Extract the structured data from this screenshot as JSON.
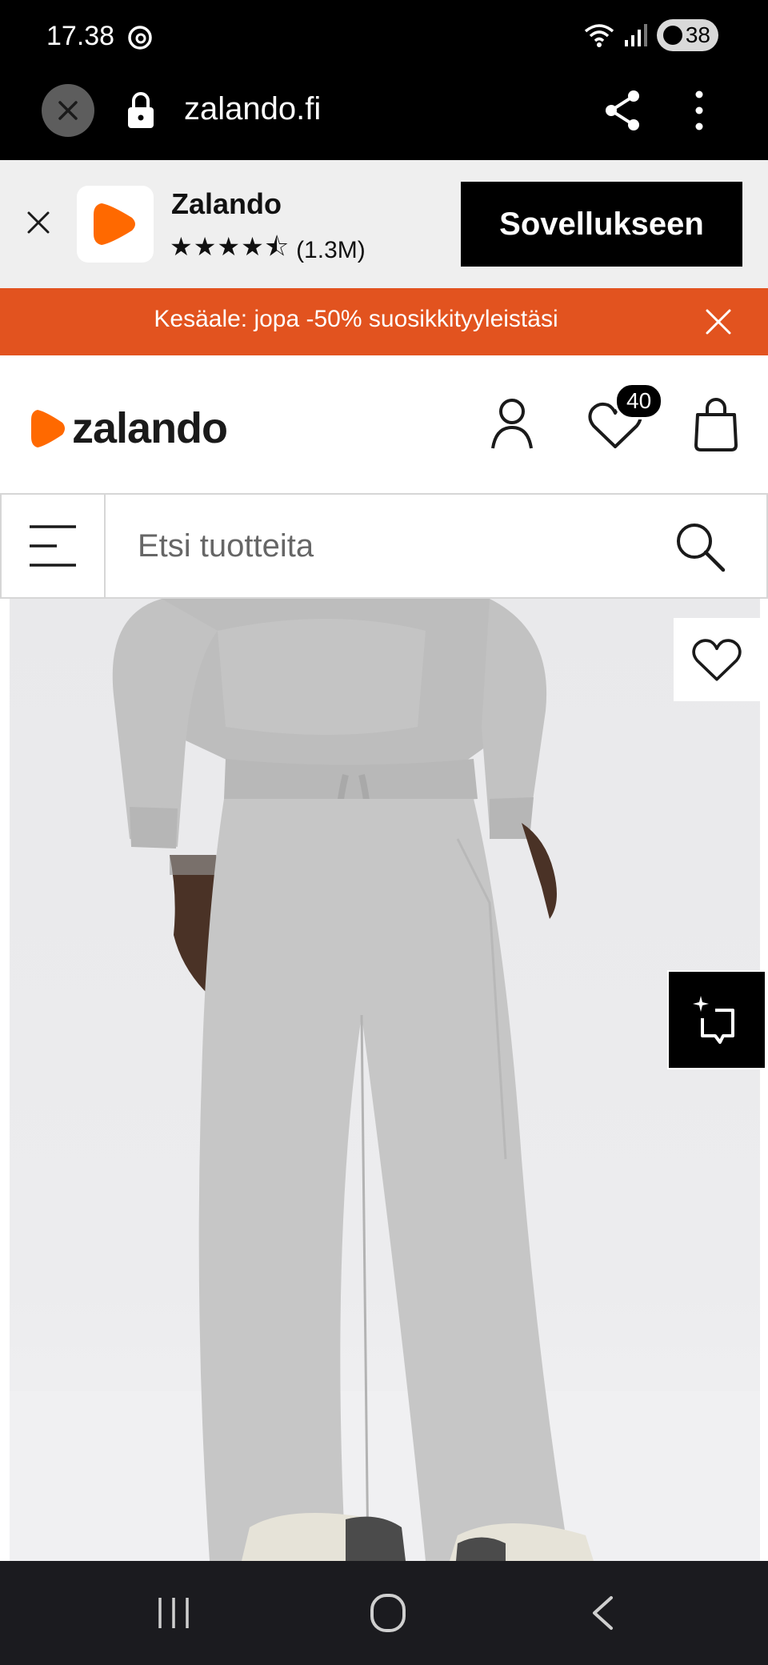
{
  "status_bar": {
    "time": "17.38",
    "battery": "38",
    "icons": [
      "threads-icon",
      "wifi-icon",
      "signal-icon",
      "battery-icon"
    ]
  },
  "browser": {
    "url": "zalando.fi",
    "icons": [
      "close-icon",
      "lock-icon",
      "share-icon",
      "more-vertical-icon"
    ]
  },
  "app_banner": {
    "app_name": "Zalando",
    "stars": "★★★★⯪",
    "rating_value": 4.5,
    "review_count": "(1.3M)",
    "cta_label": "Sovellukseen"
  },
  "promo": {
    "text": "Kesäale: jopa -50% suosikkityyleistäsi"
  },
  "header": {
    "logo_text": "zalando",
    "wishlist_count": "40"
  },
  "search": {
    "placeholder": "Etsi tuotteita"
  },
  "colors": {
    "brand_orange": "#FF6900",
    "promo_bg": "#E2531F",
    "black": "#000000"
  },
  "product": {
    "image_alt": "Grey sweatpants and hoodie on model"
  }
}
